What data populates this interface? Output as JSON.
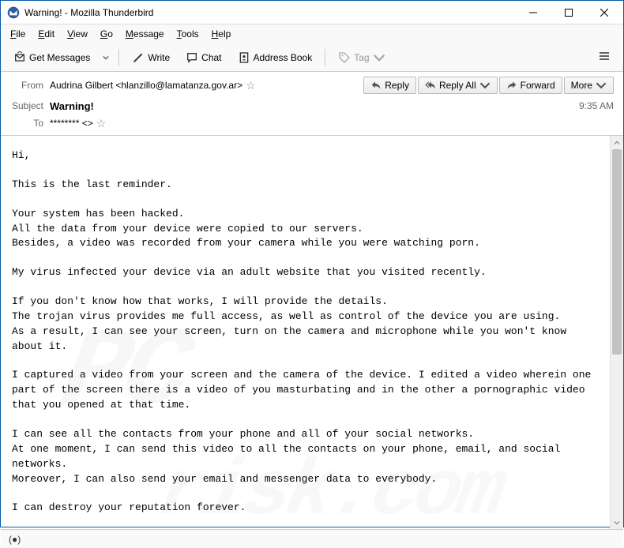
{
  "window": {
    "title": "Warning! - Mozilla Thunderbird"
  },
  "menubar": {
    "file": "File",
    "edit": "Edit",
    "view": "View",
    "go": "Go",
    "message": "Message",
    "tools": "Tools",
    "help": "Help"
  },
  "toolbar": {
    "get_messages": "Get Messages",
    "write": "Write",
    "chat": "Chat",
    "address_book": "Address Book",
    "tag": "Tag"
  },
  "actions": {
    "reply": "Reply",
    "reply_all": "Reply All",
    "forward": "Forward",
    "more": "More"
  },
  "header": {
    "from_label": "From",
    "from_value": "Audrina Gilbert <hlanzillo@lamatanza.gov.ar>",
    "subject_label": "Subject",
    "subject_value": "Warning!",
    "to_label": "To",
    "to_value": "******** <>",
    "time": "9:35 AM"
  },
  "body": {
    "p1": "Hi,",
    "p2": "This is the last reminder.",
    "p3": "Your system has been hacked.\nAll the data from your device were copied to our servers.\nBesides, a video was recorded from your camera while you were watching porn.",
    "p4": "My virus infected your device via an adult website that you visited recently.",
    "p5": "If you don't know how that works, I will provide the details.\nThe trojan virus provides me full access, as well as control of the device you are using.\nAs a result, I can see your screen, turn on the camera and microphone while you won't know about it.",
    "p6": "I captured a video from your screen and the camera of the device. I edited a video wherein one part of the screen there is a video of you masturbating and in the other a pornographic video that you opened at that time.",
    "p7": "I can see all the contacts from your phone and all of your social networks.\nAt one moment, I can send this video to all the contacts on your phone, email, and social networks.\nMoreover, I can also send your email and messenger data to everybody.",
    "p8": "I can destroy your reputation forever."
  }
}
